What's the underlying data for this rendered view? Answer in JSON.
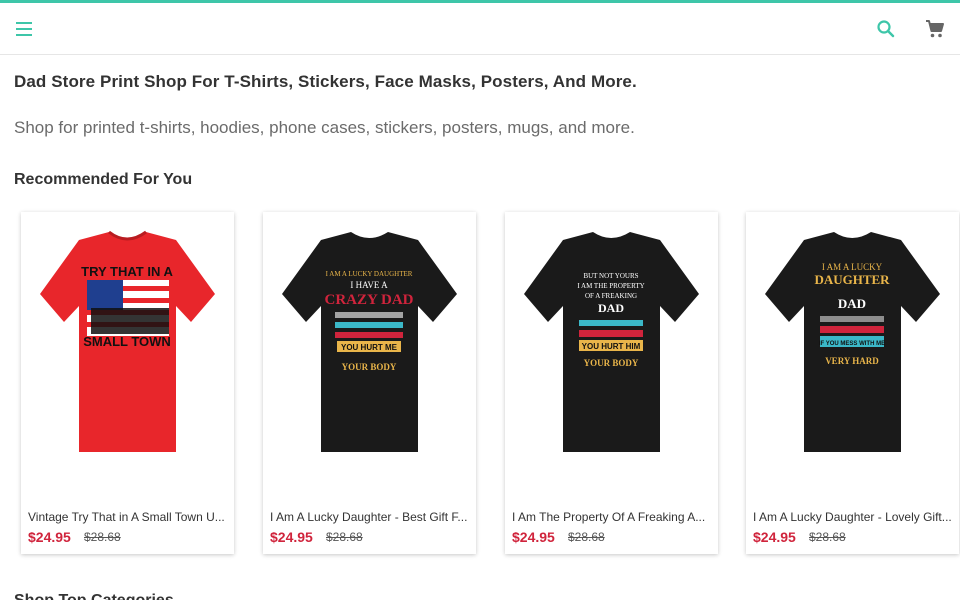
{
  "header": {
    "menu_icon": "hamburger-menu-icon",
    "search_icon": "search-icon",
    "cart_icon": "shopping-cart-icon",
    "accent": "#3ec6a9"
  },
  "page": {
    "title": "Dad Store Print Shop For T-Shirts, Stickers, Face Masks, Posters, And More.",
    "subtitle": "Shop for printed t-shirts, hoodies, phone cases, stickers, posters, mugs, and more."
  },
  "recommended": {
    "heading": "Recommended For You",
    "products": [
      {
        "name": "Vintage Try That in A Small Town U...",
        "price": "$24.95",
        "old_price": "$28.68",
        "shirt_color": "#e8262b",
        "print": [
          "TRY THAT IN A",
          "SMALL TOWN"
        ]
      },
      {
        "name": "I Am A Lucky Daughter - Best Gift F...",
        "price": "$24.95",
        "old_price": "$28.68",
        "shirt_color": "#1a1a1a",
        "print": [
          "I AM A LUCKY DAUGHTER",
          "I HAVE A",
          "CRAZY DAD",
          "YOU HURT ME",
          "YOUR BODY"
        ]
      },
      {
        "name": "I Am The Property Of A Freaking A...",
        "price": "$24.95",
        "old_price": "$28.68",
        "shirt_color": "#1a1a1a",
        "print": [
          "BUT NOT YOURS",
          "I AM THE PROPERTY",
          "OF A FREAKING",
          "DAD",
          "YOU HURT HIM",
          "YOUR BODY"
        ]
      },
      {
        "name": "I Am A Lucky Daughter - Lovely Gift...",
        "price": "$24.95",
        "old_price": "$28.68",
        "shirt_color": "#1a1a1a",
        "print": [
          "I AM A LUCKY",
          "DAUGHTER",
          "DAD",
          "IF YOU MESS WITH ME",
          "VERY HARD"
        ]
      }
    ]
  },
  "next_section": {
    "heading": "Shop Top Categories"
  },
  "colors": {
    "price": "#d0243c",
    "text": "#333333",
    "subtext": "#6b6b6b"
  }
}
